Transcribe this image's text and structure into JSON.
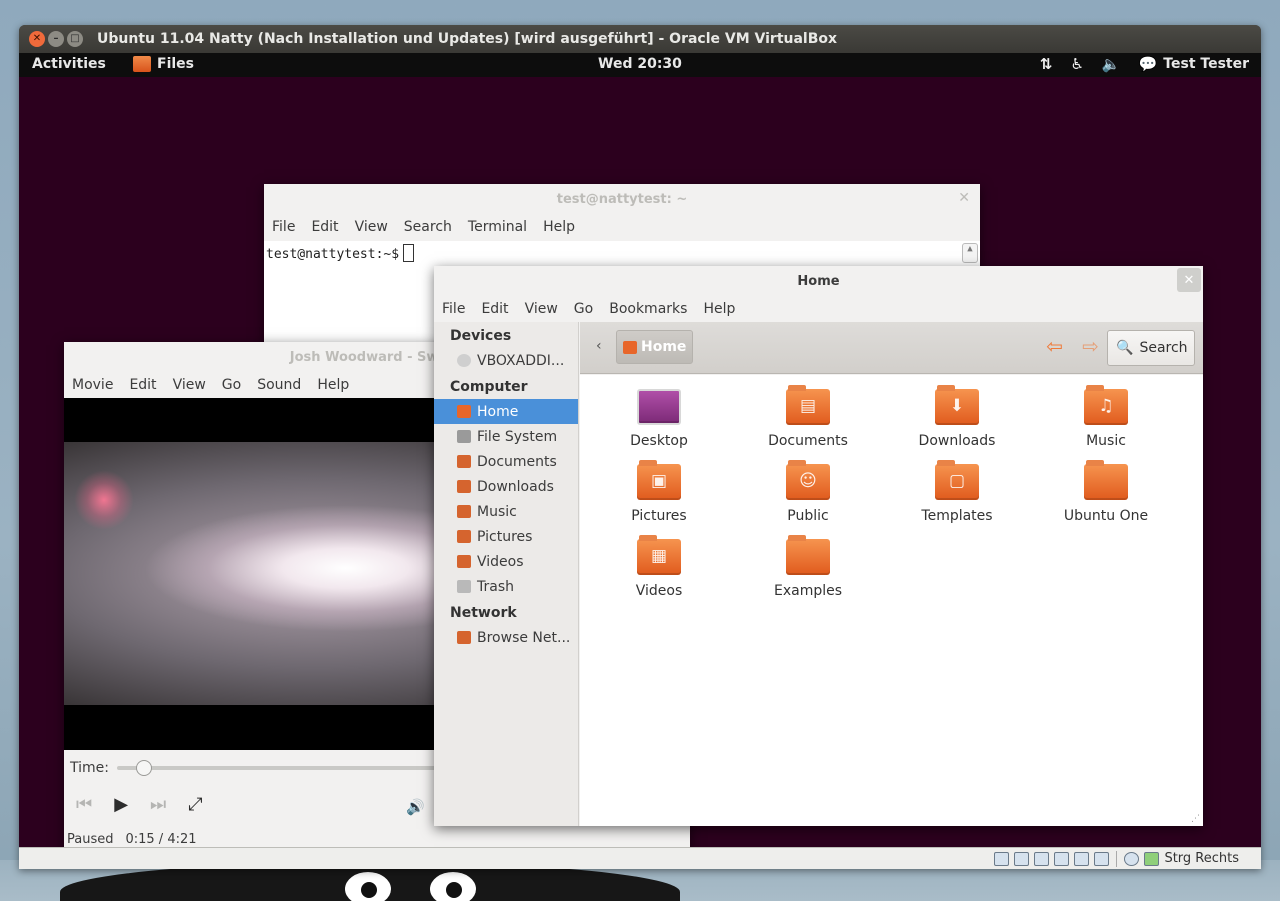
{
  "vbox": {
    "title": "Ubuntu 11.04 Natty (Nach Installation und Updates) [wird ausgeführt] - Oracle VM VirtualBox",
    "host_key": "Strg Rechts"
  },
  "panel": {
    "activities": "Activities",
    "app_name": "Files",
    "clock": "Wed 20:30",
    "user": "Test Tester"
  },
  "terminal": {
    "title": "test@nattytest: ~",
    "menu": [
      "File",
      "Edit",
      "View",
      "Search",
      "Terminal",
      "Help"
    ],
    "prompt": "test@nattytest:~$"
  },
  "totem": {
    "title": "Josh Woodward - Swans",
    "menu": [
      "Movie",
      "Edit",
      "View",
      "Go",
      "Sound",
      "Help"
    ],
    "time_label": "Time:",
    "state": "Paused",
    "position": "0:15 / 4:21",
    "seek_fraction": 0.06
  },
  "nautilus": {
    "title": "Home",
    "menu": [
      "File",
      "Edit",
      "View",
      "Go",
      "Bookmarks",
      "Help"
    ],
    "location": "Home",
    "search_label": "Search",
    "sidebar": {
      "devices_heading": "Devices",
      "devices": [
        "VBOXADDI..."
      ],
      "computer_heading": "Computer",
      "computer": [
        "Home",
        "File System",
        "Documents",
        "Downloads",
        "Music",
        "Pictures",
        "Videos",
        "Trash"
      ],
      "network_heading": "Network",
      "network": [
        "Browse Net..."
      ]
    },
    "files": [
      "Desktop",
      "Documents",
      "Downloads",
      "Music",
      "Pictures",
      "Public",
      "Templates",
      "Ubuntu One",
      "Videos",
      "Examples"
    ]
  },
  "colors": {
    "desktop": "#2c001e",
    "folder": "#e8662a",
    "selection": "#4a90d9"
  }
}
